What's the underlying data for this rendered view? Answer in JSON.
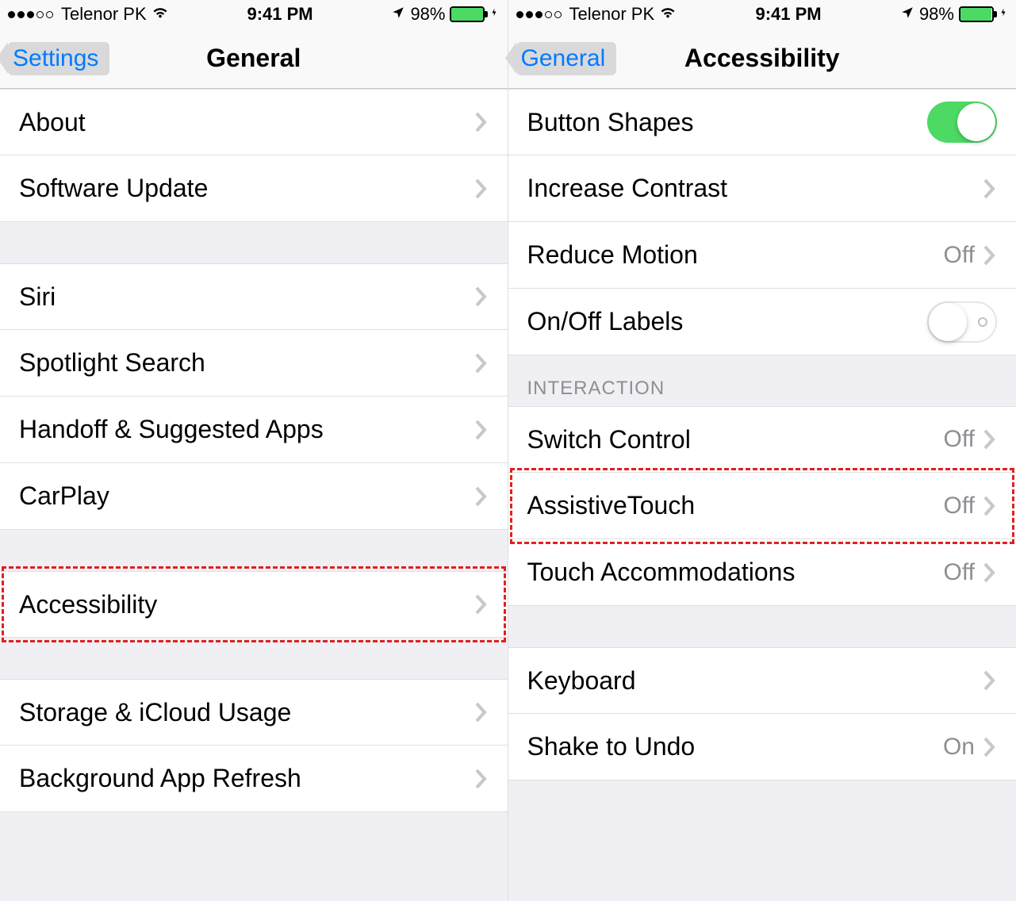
{
  "status": {
    "carrier": "Telenor PK",
    "time": "9:41 PM",
    "battery_pct": "98%"
  },
  "left": {
    "back_label": "Settings",
    "title": "General",
    "groups": [
      {
        "rows": [
          {
            "label": "About"
          },
          {
            "label": "Software Update"
          }
        ]
      },
      {
        "rows": [
          {
            "label": "Siri"
          },
          {
            "label": "Spotlight Search"
          },
          {
            "label": "Handoff & Suggested Apps"
          },
          {
            "label": "CarPlay"
          }
        ]
      },
      {
        "rows": [
          {
            "label": "Accessibility",
            "highlighted": true
          }
        ]
      },
      {
        "rows": [
          {
            "label": "Storage & iCloud Usage"
          },
          {
            "label": "Background App Refresh"
          }
        ]
      }
    ]
  },
  "right": {
    "back_label": "General",
    "title": "Accessibility",
    "rows_top": [
      {
        "label": "Button Shapes",
        "type": "toggle",
        "on": true
      },
      {
        "label": "Increase Contrast",
        "type": "disclosure"
      },
      {
        "label": "Reduce Motion",
        "type": "disclosure",
        "value": "Off"
      },
      {
        "label": "On/Off Labels",
        "type": "toggle",
        "on": false
      }
    ],
    "interaction_header": "INTERACTION",
    "rows_interaction": [
      {
        "label": "Switch Control",
        "type": "disclosure",
        "value": "Off"
      },
      {
        "label": "AssistiveTouch",
        "type": "disclosure",
        "value": "Off",
        "highlighted": true
      },
      {
        "label": "Touch Accommodations",
        "type": "disclosure",
        "value": "Off"
      }
    ],
    "rows_bottom": [
      {
        "label": "Keyboard",
        "type": "disclosure"
      },
      {
        "label": "Shake to Undo",
        "type": "disclosure",
        "value": "On"
      }
    ]
  }
}
